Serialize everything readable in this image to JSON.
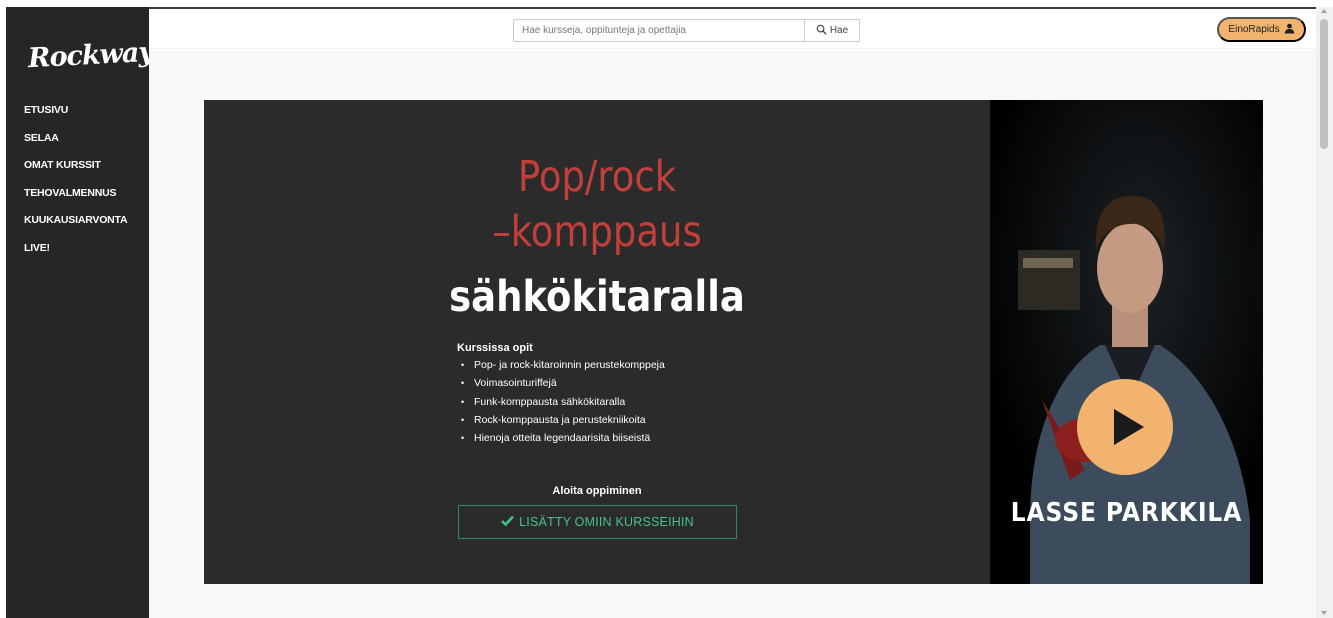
{
  "app": {
    "logo": "Rockway"
  },
  "sidebar": {
    "items": [
      {
        "label": "ETUSIVU"
      },
      {
        "label": "SELAA"
      },
      {
        "label": "OMAT KURSSIT"
      },
      {
        "label": "TEHOVALMENNUS"
      },
      {
        "label": "KUUKAUSIARVONTA"
      },
      {
        "label": "LIVE!"
      }
    ]
  },
  "header": {
    "search_placeholder": "Hae kursseja, oppitunteja ja opettajia",
    "search_value": "",
    "search_button": "Hae",
    "user_name": "EinoRapids"
  },
  "course": {
    "title_line1": "Pop/rock",
    "title_line2": "–komppaus",
    "title_line3": "sähkökitaralla",
    "learn_heading": "Kurssissa opit",
    "learn_items": [
      "Pop- ja rock-kitaroinnin perustekomppeja",
      "Voimasointuriffejä",
      "Funk-komppausta sähkökitaralla",
      "Rock-komppausta ja perustekniikoita",
      "Hienoja otteita legendaarisita biiseistä"
    ],
    "start_heading": "Aloita oppiminen",
    "added_button": "LISÄTTY OMIIN KURSSEIHIN",
    "teacher_name": "LASSE PARKKILA"
  },
  "colors": {
    "sidebar_bg": "#262626",
    "accent_orange": "#f1b36d",
    "title_red": "#c2403b",
    "added_green": "#47c28a"
  },
  "icons": {
    "search": "search-icon",
    "user": "user-icon",
    "check": "check-icon",
    "play": "play-icon"
  }
}
